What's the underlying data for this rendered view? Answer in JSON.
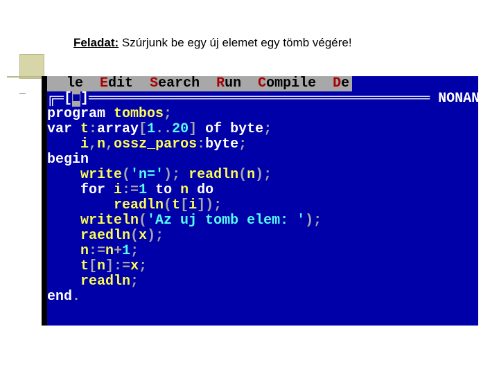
{
  "task": {
    "label": "Feladat:",
    "text": " Szúrjunk be egy új elemet egy tömb végére!"
  },
  "menu": {
    "spacer": "  ",
    "file": "le  ",
    "e_h": "E",
    "e_r": "dit  ",
    "s_h": "S",
    "s_r": "earch  ",
    "r_h": "R",
    "r_r": "un  ",
    "c_h": "C",
    "c_r": "ompile  ",
    "d_h": "D",
    "d_r": "e"
  },
  "frame": {
    "left": "╔═[",
    "box": "■",
    "mid": "]═════════════════════════════════════════ ",
    "name": "NONAN"
  },
  "code": {
    "l1a": "program ",
    "l1b": "tombos",
    "l1c": ";",
    "l2a": "var ",
    "l2b": "t",
    "l2c": ":",
    "l2d": "array",
    "l2e": "[",
    "l2f": "1",
    "l2g": ".",
    "l2h": ".",
    "l2i": "20",
    "l2j": "] ",
    "l2k": "of ",
    "l2l": "byte",
    "l2m": ";",
    "l3a": "    i",
    "l3b": ",",
    "l3c": "n",
    "l3d": ",",
    "l3e": "ossz_paros",
    "l3f": ":",
    "l3g": "byte",
    "l3h": ";",
    "l4": "begin",
    "l5a": "    write",
    "l5b": "(",
    "l5c": "'n='",
    "l5d": "); ",
    "l5e": "readln",
    "l5f": "(",
    "l5g": "n",
    "l5h": ");",
    "l6a": "    for ",
    "l6b": "i",
    "l6c": ":",
    "l6d": "=",
    "l6e": "1 ",
    "l6f": "to ",
    "l6g": "n ",
    "l6h": "do",
    "l7a": "        readln",
    "l7b": "(",
    "l7c": "t",
    "l7d": "[",
    "l7e": "i",
    "l7f": "]);",
    "l8a": "    writeln",
    "l8b": "(",
    "l8c": "'Az uj tomb elem: '",
    "l8d": ");",
    "l9a": "    raedln",
    "l9b": "(",
    "l9c": "x",
    "l9d": ");",
    "l10a": "    n",
    "l10b": ":",
    "l10c": "=",
    "l10d": "n",
    "l10e": "+",
    "l10f": "1",
    "l10g": ";",
    "l11a": "    t",
    "l11b": "[",
    "l11c": "n",
    "l11d": "]:",
    "l11e": "=",
    "l11f": "x",
    "l11g": ";",
    "l12a": "    readln",
    "l12b": ";",
    "l13a": "end",
    "l13b": "."
  }
}
